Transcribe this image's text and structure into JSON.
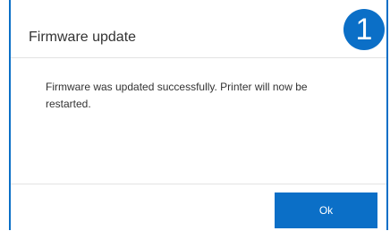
{
  "dialog": {
    "title": "Firmware update",
    "step_badge": "1",
    "message": "Firmware was updated successfully. Printer will now be restarted.",
    "ok_label": "Ok"
  },
  "colors": {
    "accent": "#0b6fc7",
    "text": "#333333",
    "divider": "#e3e3e3",
    "background": "#ffffff"
  }
}
